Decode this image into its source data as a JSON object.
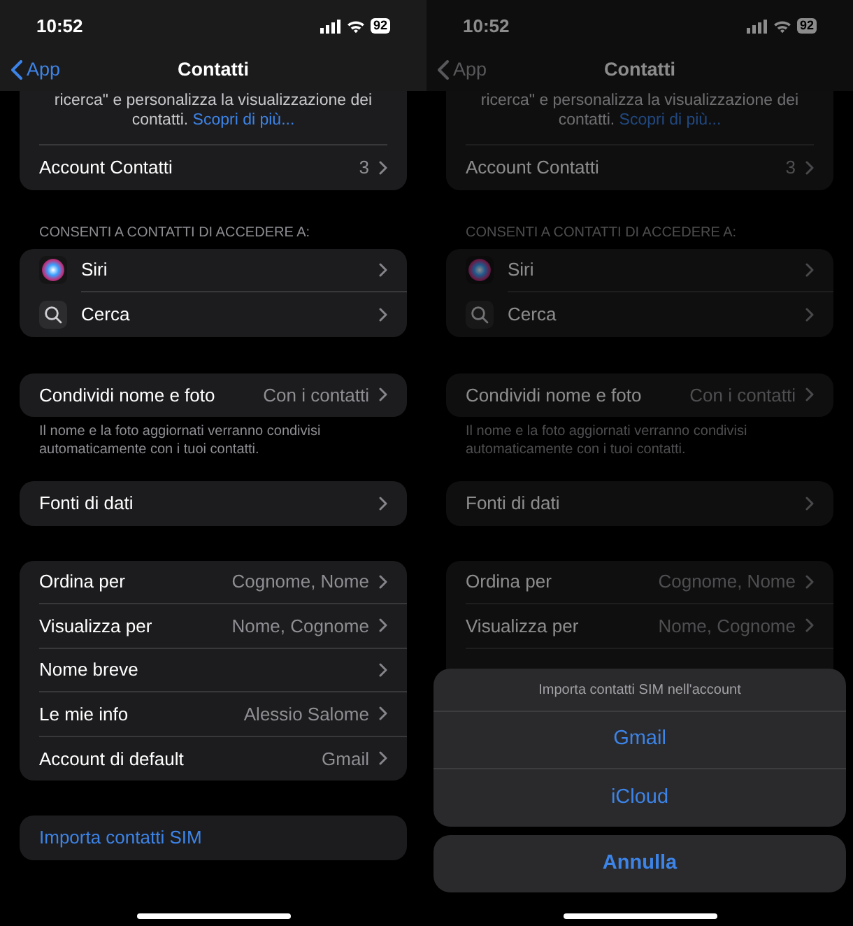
{
  "screens": [
    {
      "dimmed": false,
      "status": {
        "time": "10:52",
        "battery": "92"
      },
      "nav": {
        "back": "App",
        "title": "Contatti",
        "back_disabled": false
      },
      "groups": [
        {
          "rows": [
            {
              "kind": "note",
              "label": "ricerca\" e personalizza la visualizzazione dei contatti.",
              "link": "Scopri di più..."
            },
            {
              "kind": "nav",
              "label": "Account Contatti",
              "value": "3"
            }
          ]
        },
        {
          "header": "CONSENTI A CONTATTI DI ACCEDERE A:",
          "rows": [
            {
              "kind": "siri",
              "label": "Siri"
            },
            {
              "kind": "search",
              "label": "Cerca"
            }
          ]
        },
        {
          "rows": [
            {
              "kind": "nav",
              "label": "Condividi nome e foto",
              "value": "Con i contatti"
            }
          ],
          "footer": "Il nome e la foto aggiornati verranno condivisi automaticamente con i tuoi contatti."
        },
        {
          "rows": [
            {
              "kind": "nav",
              "label": "Fonti di dati"
            }
          ]
        },
        {
          "rows": [
            {
              "kind": "nav",
              "label": "Ordina per",
              "value": "Cognome, Nome"
            },
            {
              "kind": "nav",
              "label": "Visualizza per",
              "value": "Nome, Cognome"
            },
            {
              "kind": "nav",
              "label": "Nome breve"
            },
            {
              "kind": "nav",
              "label": "Le mie info",
              "value": "Alessio Salome"
            },
            {
              "kind": "nav",
              "label": "Account di default",
              "value": "Gmail"
            }
          ]
        },
        {
          "rows": [
            {
              "kind": "action",
              "label": "Importa contatti SIM"
            }
          ]
        }
      ]
    },
    {
      "dimmed": true,
      "status": {
        "time": "10:52",
        "battery": "92"
      },
      "nav": {
        "back": "App",
        "title": "Contatti",
        "back_disabled": true
      },
      "groups": [
        {
          "rows": [
            {
              "kind": "note",
              "label": "ricerca\" e personalizza la visualizzazione dei contatti.",
              "link": "Scopri di più..."
            },
            {
              "kind": "nav",
              "label": "Account Contatti",
              "value": "3"
            }
          ]
        },
        {
          "header": "CONSENTI A CONTATTI DI ACCEDERE A:",
          "rows": [
            {
              "kind": "siri",
              "label": "Siri"
            },
            {
              "kind": "search",
              "label": "Cerca"
            }
          ]
        },
        {
          "rows": [
            {
              "kind": "nav",
              "label": "Condividi nome e foto",
              "value": "Con i contatti"
            }
          ],
          "footer": "Il nome e la foto aggiornati verranno condivisi automaticamente con i tuoi contatti."
        },
        {
          "rows": [
            {
              "kind": "nav",
              "label": "Fonti di dati"
            }
          ]
        },
        {
          "rows": [
            {
              "kind": "nav",
              "label": "Ordina per",
              "value": "Cognome, Nome"
            },
            {
              "kind": "nav",
              "label": "Visualizza per",
              "value": "Nome, Cognome"
            },
            {
              "kind": "nav"
            }
          ]
        }
      ],
      "action_sheet": {
        "title": "Importa contatti SIM nell'account",
        "options": [
          "Gmail",
          "iCloud"
        ],
        "cancel": "Annulla"
      }
    }
  ]
}
